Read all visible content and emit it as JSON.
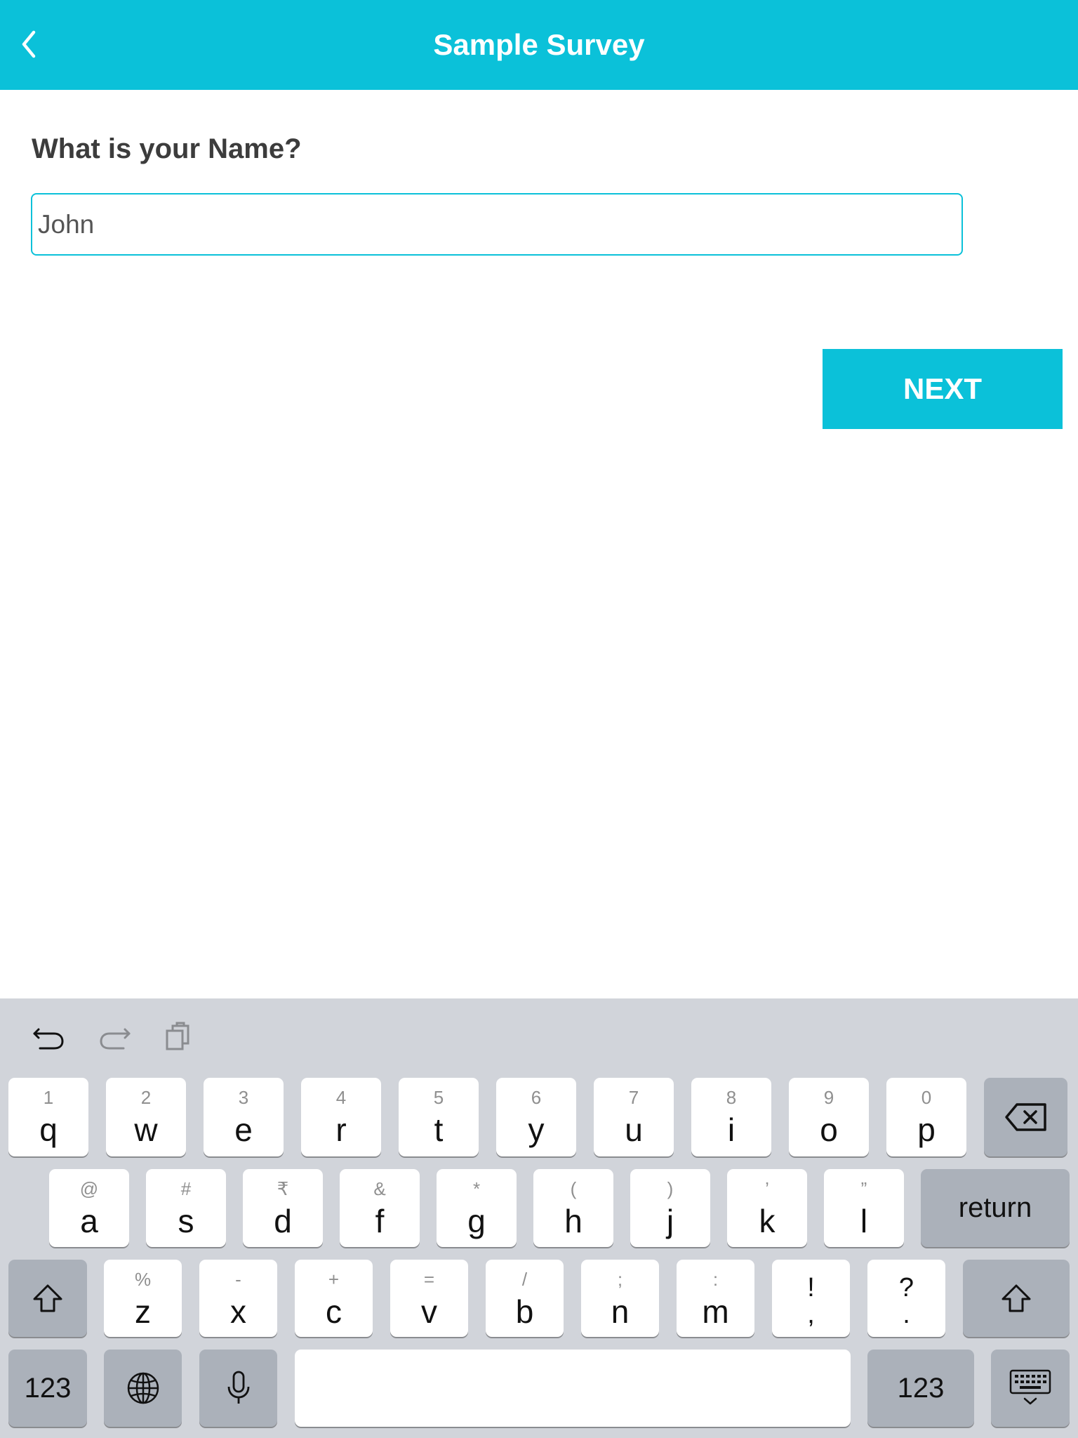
{
  "header": {
    "title": "Sample Survey",
    "back_icon": "chevron-left-icon",
    "background": "#0bc1d9"
  },
  "form": {
    "question": "What is your Name?",
    "answer_value": "John",
    "next_label": "NEXT"
  },
  "keyboard": {
    "tools": [
      "undo-icon",
      "redo-icon",
      "clipboard-icon"
    ],
    "row1": [
      {
        "hint": "1",
        "key": "q"
      },
      {
        "hint": "2",
        "key": "w"
      },
      {
        "hint": "3",
        "key": "e"
      },
      {
        "hint": "4",
        "key": "r"
      },
      {
        "hint": "5",
        "key": "t"
      },
      {
        "hint": "6",
        "key": "y"
      },
      {
        "hint": "7",
        "key": "u"
      },
      {
        "hint": "8",
        "key": "i"
      },
      {
        "hint": "9",
        "key": "o"
      },
      {
        "hint": "0",
        "key": "p"
      }
    ],
    "row2": [
      {
        "hint": "@",
        "key": "a"
      },
      {
        "hint": "#",
        "key": "s"
      },
      {
        "hint": "₹",
        "key": "d"
      },
      {
        "hint": "&",
        "key": "f"
      },
      {
        "hint": "*",
        "key": "g"
      },
      {
        "hint": "(",
        "key": "h"
      },
      {
        "hint": ")",
        "key": "j"
      },
      {
        "hint": "’",
        "key": "k"
      },
      {
        "hint": "”",
        "key": "l"
      }
    ],
    "row3": [
      {
        "hint": "%",
        "key": "z"
      },
      {
        "hint": "-",
        "key": "x"
      },
      {
        "hint": "+",
        "key": "c"
      },
      {
        "hint": "=",
        "key": "v"
      },
      {
        "hint": "/",
        "key": "b"
      },
      {
        "hint": ";",
        "key": "n"
      },
      {
        "hint": ":",
        "key": "m"
      }
    ],
    "punct": [
      {
        "top": "!",
        "bottom": ","
      },
      {
        "top": "?",
        "bottom": "."
      }
    ],
    "return_label": "return",
    "numbers_label": "123",
    "delete_icon": "backspace-icon",
    "shift_icon": "shift-icon",
    "globe_icon": "globe-icon",
    "mic_icon": "microphone-icon",
    "dismiss_icon": "keyboard-dismiss-icon"
  }
}
